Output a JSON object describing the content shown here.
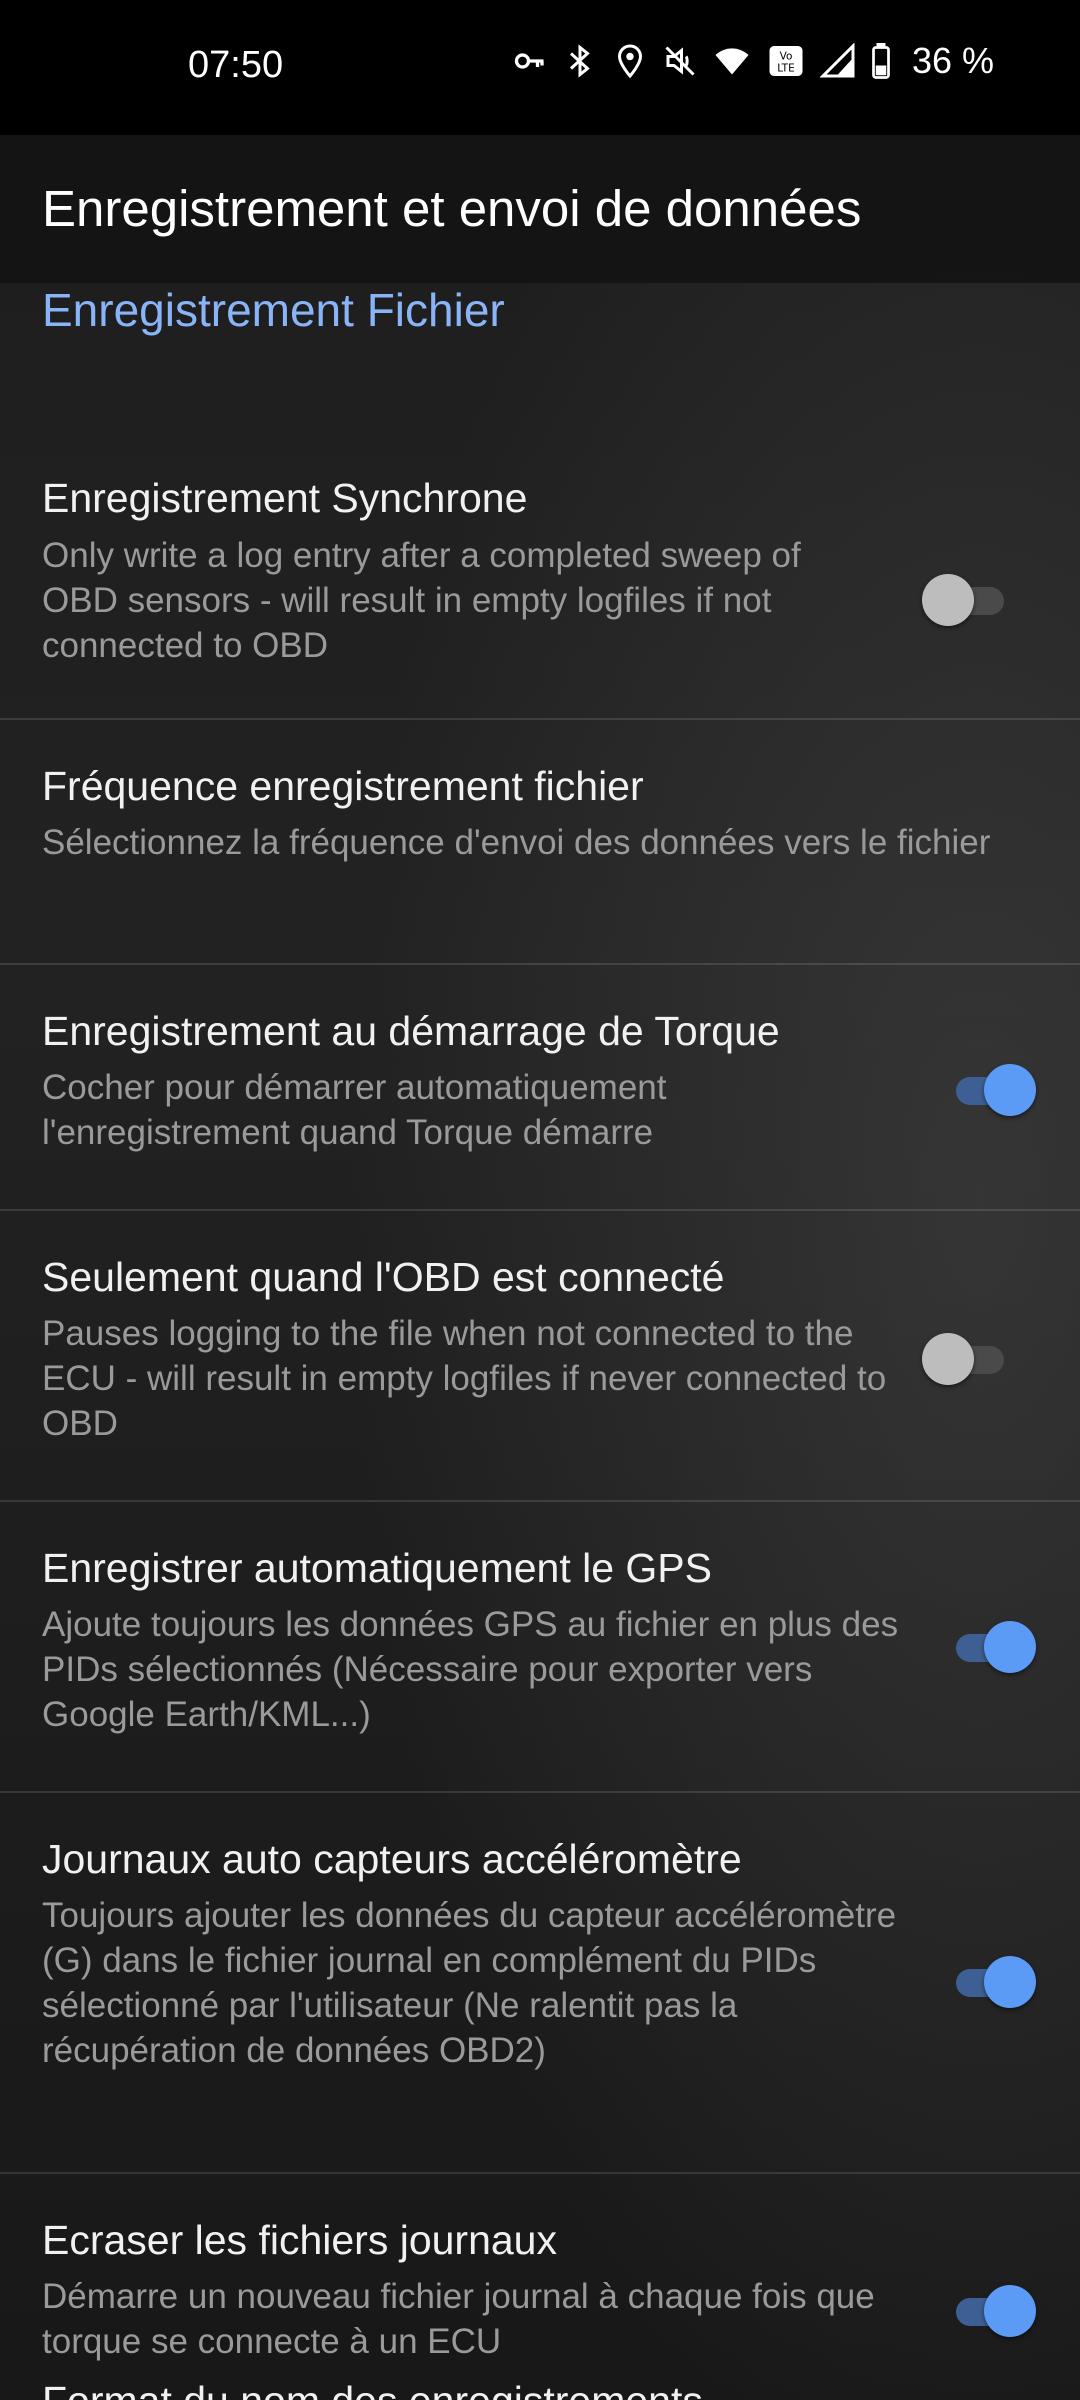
{
  "status_bar": {
    "time": "07:50",
    "battery_text": "36 %",
    "icons": [
      "key-icon",
      "bluetooth-icon",
      "location-icon",
      "mute-icon",
      "wifi-icon",
      "volte-icon",
      "signal-icon",
      "battery-icon"
    ]
  },
  "app_bar": {
    "title": "Enregistrement et envoi de données"
  },
  "category": {
    "title": "Enregistrement Fichier"
  },
  "prefs": [
    {
      "title": "Enregistrement Synchrone",
      "summary": "Only write a log entry after a completed sweep of OBD sensors - will result in empty logfiles if not connected to OBD",
      "switch": "off"
    },
    {
      "title": "Fréquence enregistrement fichier",
      "summary": "Sélectionnez la fréquence d'envoi des données vers le fichier"
    },
    {
      "title": "Enregistrement au démarrage de Torque",
      "summary": "Cocher pour démarrer automatiquement l'enregistrement quand Torque démarre",
      "switch": "on"
    },
    {
      "title": "Seulement quand l'OBD est connecté",
      "summary": "Pauses logging to the file when not connected to the ECU - will result in empty logfiles if never connected to OBD",
      "switch": "off"
    },
    {
      "title": "Enregistrer automatiquement le GPS",
      "summary": "Ajoute toujours les données GPS au fichier en plus des PIDs sélectionnés (Nécessaire pour exporter vers Google Earth/KML...)",
      "switch": "on"
    },
    {
      "title": "Journaux auto capteurs accéléromètre",
      "summary": "Toujours ajouter les données du capteur accéléromètre (G) dans le fichier journal en complément du PIDs sélectionné par l'utilisateur (Ne ralentit pas la récupération de données OBD2)",
      "switch": "on"
    },
    {
      "title": "Ecraser les fichiers journaux",
      "summary": "Démarre un nouveau fichier journal à chaque fois que torque se connecte à un ECU",
      "switch": "on"
    },
    {
      "title": "Format du nom des enregistrements"
    }
  ],
  "colors": {
    "accent": "#8ab4f8",
    "switch_on": "#5b9bf5",
    "switch_off": "#bdbdbd"
  }
}
